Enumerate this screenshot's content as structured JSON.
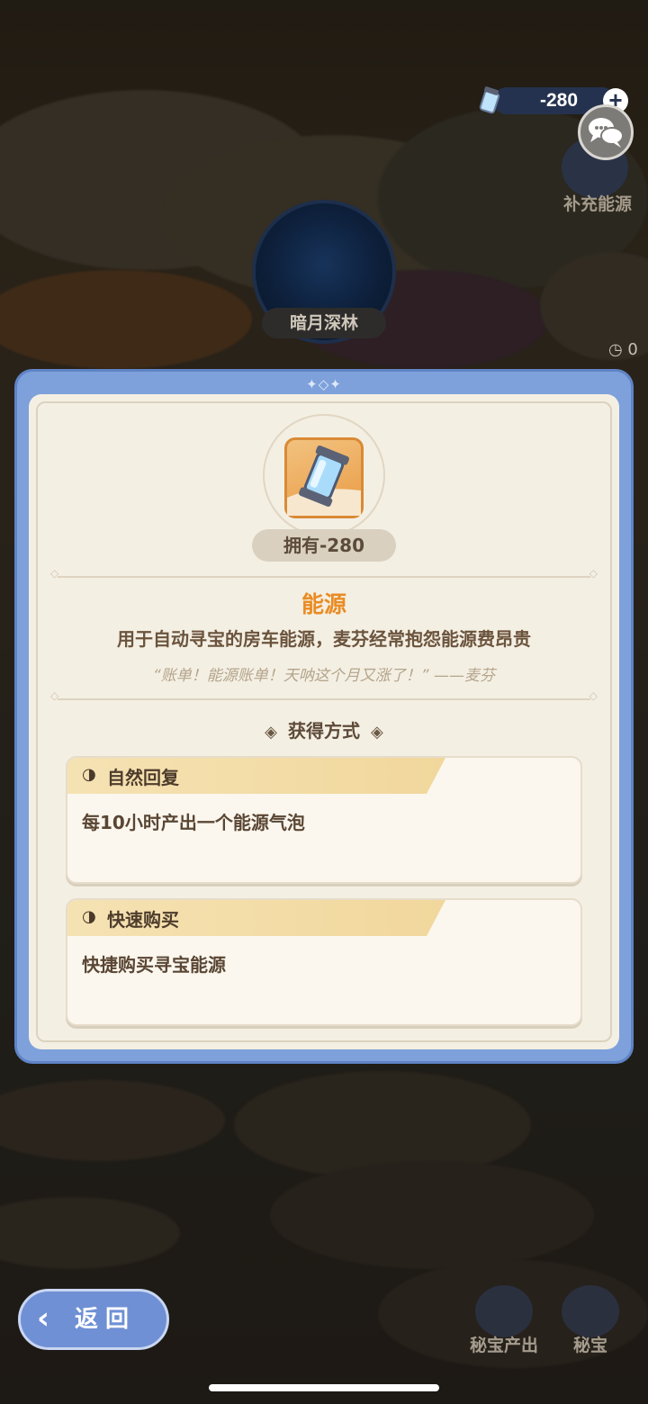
{
  "hud": {
    "energy_value": "-280",
    "plus_label": "+",
    "refill_label": "补充能源"
  },
  "map": {
    "location_label": "暗月深林",
    "timer_text": "◷ 0"
  },
  "modal": {
    "owned_label": "拥有-280",
    "title": "能源",
    "description": "用于自动寻宝的房车能源，麦芬经常抱怨能源费昂贵",
    "quote": "“账单！能源账单！天呐这个月又涨了！” ——麦芬",
    "obtain_header": "获得方式",
    "methods": [
      {
        "title": "自然回复",
        "body": "每10小时产出一个能源气泡"
      },
      {
        "title": "快速购买",
        "body": "快捷购买寻宝能源"
      }
    ]
  },
  "bottom": {
    "back_label": "返回",
    "treasure_output_label": "秘宝产出",
    "treasure_label": "秘宝"
  },
  "colors": {
    "modal_frame": "#7ea1dc",
    "panel_bg": "#f4efe3",
    "title_orange": "#e98c23",
    "back_button": "#6f90d4"
  }
}
